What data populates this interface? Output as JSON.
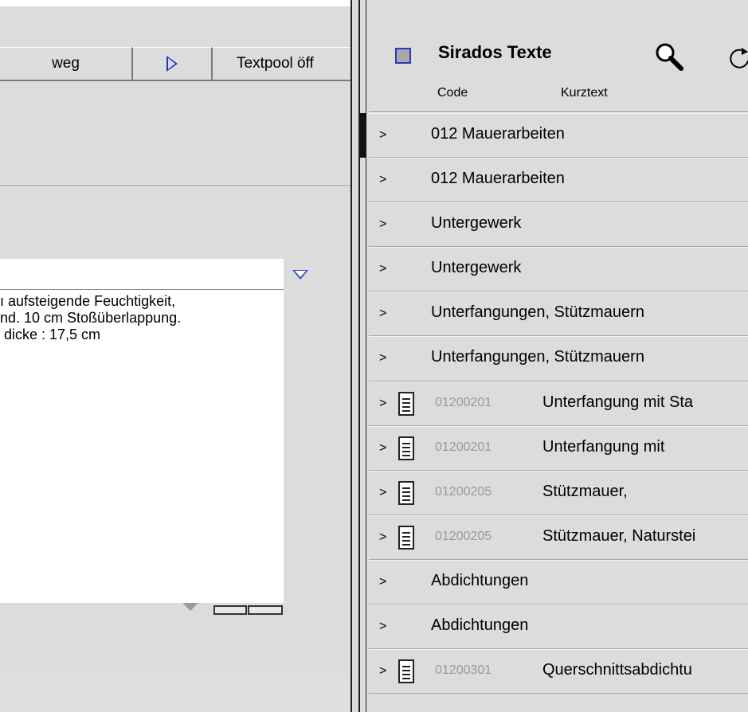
{
  "left_pane": {
    "toolbar": {
      "weg_label": "weg",
      "textpool_label": "Textpool öff"
    },
    "text_body": "ı aufsteigende Feuchtigkeit,\nnd. 10 cm Stoßüberlappung.\n dicke : 17,5 cm"
  },
  "right_pane": {
    "title": "Sirados Texte",
    "columns": {
      "code": "Code",
      "kurztext": "Kurztext"
    },
    "rows": [
      {
        "chevron": ">",
        "code": "",
        "text": "012 Mauerarbeiten"
      },
      {
        "chevron": ">",
        "code": "",
        "text": "012 Mauerarbeiten"
      },
      {
        "chevron": ">",
        "code": "",
        "text": "Untergewerk"
      },
      {
        "chevron": ">",
        "code": "",
        "text": "Untergewerk"
      },
      {
        "chevron": ">",
        "code": "",
        "text": "Unterfangungen, Stützmauern"
      },
      {
        "chevron": ">",
        "code": "",
        "text": "Unterfangungen, Stützmauern"
      },
      {
        "chevron": ">",
        "code": "01200201",
        "text": "Unterfangung mit Sta"
      },
      {
        "chevron": ">",
        "code": "01200201",
        "text": "Unterfangung mit"
      },
      {
        "chevron": ">",
        "code": "01200205",
        "text": "Stützmauer,"
      },
      {
        "chevron": ">",
        "code": "01200205",
        "text": "Stützmauer, Naturstei"
      },
      {
        "chevron": ">",
        "code": "",
        "text": "Abdichtungen"
      },
      {
        "chevron": ">",
        "code": "",
        "text": "Abdichtungen"
      },
      {
        "chevron": ">",
        "code": "01200301",
        "text": "Querschnittsabdichtu"
      }
    ]
  },
  "icons": {
    "search": "magnifier-icon",
    "refresh": "refresh-icon",
    "document": "document-icon",
    "play": "play-icon",
    "dropdown": "dropdown-arrow-icon"
  },
  "colors": {
    "background": "#dcdcdc",
    "accent_blue": "#2a3ab8",
    "code_grey": "#999999"
  }
}
